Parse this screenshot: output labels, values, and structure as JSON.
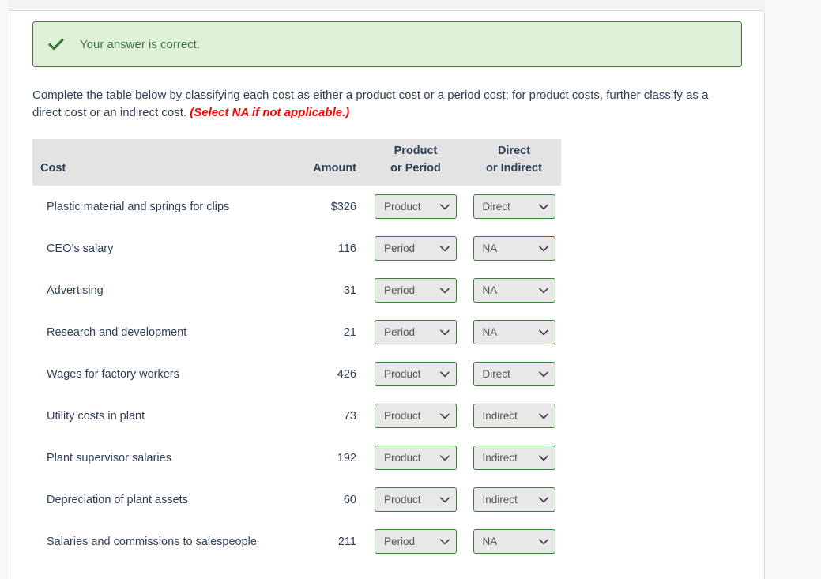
{
  "alert": {
    "icon": "check-icon",
    "message": "Your answer is correct.",
    "background_color": "#dff0d8",
    "border_color": "#3c763d",
    "text_color": "#3c763d"
  },
  "instruction": {
    "text": "Complete the table below by classifying each cost as either a product cost or a period cost; for product costs, further classify as a direct cost or an indirect cost.",
    "note": "(Select NA if not applicable.)",
    "note_color": "#ff0000"
  },
  "table": {
    "headers": {
      "cost": "Cost",
      "amount": "Amount",
      "product_or_period_line1": "Product",
      "product_or_period_line2": "or Period",
      "direct_or_indirect_line1": "Direct",
      "direct_or_indirect_line2": "or Indirect"
    },
    "header_background": "#e3e3e3",
    "select_border_color": "#3a7d36",
    "select_background": "#e8e8e8",
    "rows": [
      {
        "cost": "Plastic material and springs for clips",
        "amount": "$326",
        "product_or_period": "Product",
        "direct_or_indirect": "Direct"
      },
      {
        "cost": "CEO’s salary",
        "amount": "116",
        "product_or_period": "Period",
        "direct_or_indirect": "NA"
      },
      {
        "cost": "Advertising",
        "amount": "31",
        "product_or_period": "Period",
        "direct_or_indirect": "NA"
      },
      {
        "cost": "Research and development",
        "amount": "21",
        "product_or_period": "Period",
        "direct_or_indirect": "NA"
      },
      {
        "cost": "Wages for factory workers",
        "amount": "426",
        "product_or_period": "Product",
        "direct_or_indirect": "Direct"
      },
      {
        "cost": "Utility costs in plant",
        "amount": "73",
        "product_or_period": "Product",
        "direct_or_indirect": "Indirect"
      },
      {
        "cost": "Plant supervisor salaries",
        "amount": "192",
        "product_or_period": "Product",
        "direct_or_indirect": "Indirect"
      },
      {
        "cost": "Depreciation of plant assets",
        "amount": "60",
        "product_or_period": "Product",
        "direct_or_indirect": "Indirect"
      },
      {
        "cost": "Salaries and commissions to salespeople",
        "amount": "211",
        "product_or_period": "Period",
        "direct_or_indirect": "NA"
      }
    ]
  }
}
